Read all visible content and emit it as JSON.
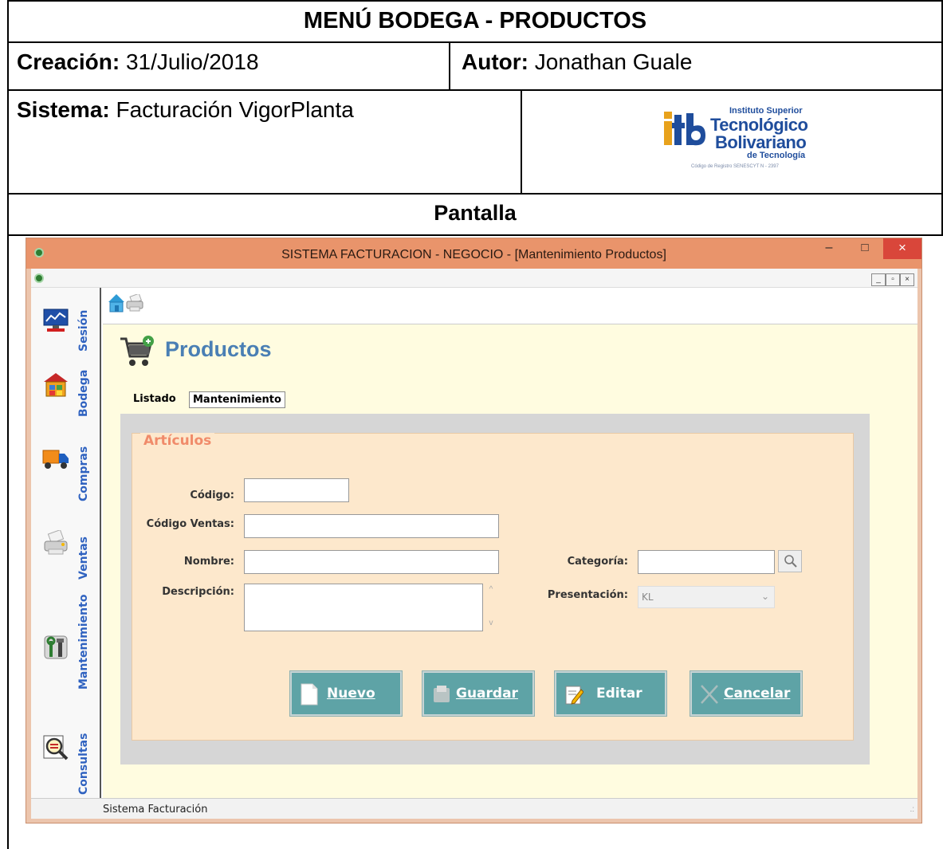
{
  "document": {
    "title": "MENÚ BODEGA - PRODUCTOS",
    "creacion_label": "Creación:",
    "creacion_value": "31/Julio/2018",
    "autor_label": "Autor:",
    "autor_value": "Jonathan Guale",
    "sistema_label": "Sistema:",
    "sistema_value": "Facturación VigorPlanta",
    "pantalla": "Pantalla",
    "logo": {
      "line1": "Instituto Superior",
      "line2": "Tecnológico",
      "line3": "Bolivariano",
      "line4": "de Tecnología",
      "line5": "Código de Registro SENESCYT N - 2397"
    }
  },
  "window": {
    "title": "SISTEMA FACTURACION - NEGOCIO - [Mantenimiento Productos]",
    "minimize": "–",
    "maximize": "□",
    "close": "×"
  },
  "sidebar": {
    "items": [
      {
        "label": "Sesión",
        "icon": "monitor-chart-icon"
      },
      {
        "label": "Bodega",
        "icon": "warehouse-icon"
      },
      {
        "label": "Compras",
        "icon": "truck-icon"
      },
      {
        "label": "Ventas",
        "icon": "printer-icon"
      },
      {
        "label": "Mantenimiento",
        "icon": "tools-icon"
      },
      {
        "label": "Consultas",
        "icon": "magnifier-icon"
      }
    ]
  },
  "main": {
    "heading": "Productos",
    "tabs": [
      "Listado",
      "Mantenimiento"
    ],
    "active_tab": "Mantenimiento",
    "group_title": "Artículos",
    "fields": {
      "codigo_label": "Código:",
      "codigo_ventas_label": "Código Ventas:",
      "nombre_label": "Nombre:",
      "descripcion_label": "Descripción:",
      "categoria_label": "Categoría:",
      "presentacion_label": "Presentación:",
      "presentacion_value": "KL"
    },
    "buttons": {
      "nuevo": "Nuevo",
      "guardar": "Guardar",
      "editar": "Editar",
      "cancelar": "Cancelar"
    }
  },
  "status_bar": {
    "text": "Sistema Facturación"
  },
  "colors": {
    "title_bar": "#e9946b",
    "sidebar_label": "#2f62c0",
    "heading": "#4a7fb4",
    "button": "#5ea3a6",
    "group_title": "#f08b6a"
  }
}
